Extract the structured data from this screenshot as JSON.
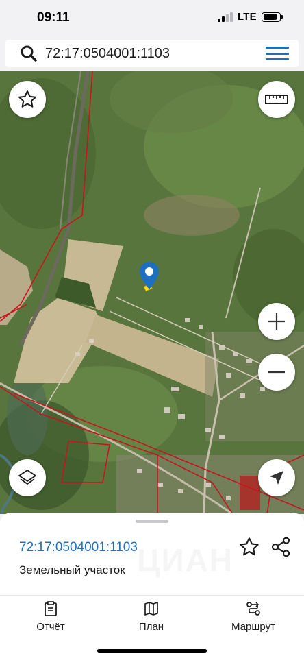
{
  "status_bar": {
    "time": "09:11",
    "network": "LTE",
    "signal_bars": 2,
    "battery_level": 0.86
  },
  "search": {
    "value": "72:17:0504001:1103",
    "icon": "search-icon",
    "menu_icon": "hamburger-menu-icon"
  },
  "map": {
    "buttons": [
      {
        "name": "favorite-star-button",
        "icon": "star-outline-icon"
      },
      {
        "name": "ruler-button",
        "icon": "ruler-icon"
      },
      {
        "name": "zoom-in-button",
        "icon": "plus-icon"
      },
      {
        "name": "zoom-out-button",
        "icon": "minus-icon"
      },
      {
        "name": "layers-button",
        "icon": "layers-icon"
      },
      {
        "name": "my-location-button",
        "icon": "navigation-arrow-icon"
      }
    ],
    "pin_color": "#1d6fc0",
    "parcel_highlight": "#ffe600",
    "boundary_color": "#c8141e"
  },
  "sheet": {
    "parcel_id": "72:17:0504001:1103",
    "parcel_type": "Земельный участок",
    "star_icon": "star-outline-icon",
    "share_icon": "share-icon",
    "watermark": "ЦИАН"
  },
  "bottom_nav": {
    "items": [
      {
        "label": "Отчёт",
        "icon": "report-clipboard-icon"
      },
      {
        "label": "План",
        "icon": "map-plan-icon"
      },
      {
        "label": "Маршрут",
        "icon": "route-icon"
      }
    ]
  },
  "colors": {
    "accent": "#1d6fc0",
    "background": "#f2f2f4"
  }
}
